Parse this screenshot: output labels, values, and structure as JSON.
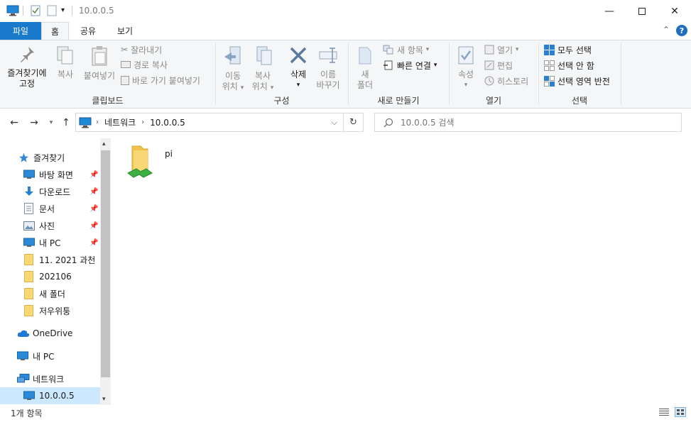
{
  "window": {
    "title": "10.0.0.5",
    "minimize_icon": "minimize-icon",
    "maximize_icon": "maximize-icon",
    "close_icon": "close-icon"
  },
  "ribbon_tabs": [
    "파일",
    "홈",
    "공유",
    "보기"
  ],
  "ribbon": {
    "clipboard": {
      "label": "클립보드",
      "pin_quick": [
        "즐겨찾기에",
        "고정"
      ],
      "copy": "복사",
      "paste": "붙여넣기",
      "cut": "잘라내기",
      "copy_path": "경로 복사",
      "paste_shortcut": "바로 가기 붙여넣기"
    },
    "organize": {
      "label": "구성",
      "move_to": [
        "이동",
        "위치"
      ],
      "copy_to": [
        "복사",
        "위치"
      ],
      "delete": "삭제",
      "rename": [
        "이름",
        "바꾸기"
      ]
    },
    "new": {
      "label": "새로 만들기",
      "new_folder": [
        "새",
        "폴더"
      ],
      "new_item": "새 항목",
      "easy_access": "빠른 연결"
    },
    "open": {
      "label": "열기",
      "properties": "속성",
      "open": "열기",
      "edit": "편집",
      "history": "히스토리"
    },
    "select": {
      "label": "선택",
      "select_all": "모두 선택",
      "select_none": "선택 안 함",
      "invert": "선택 영역 반전"
    }
  },
  "address": {
    "crumbs": [
      "네트워크",
      "10.0.0.5"
    ],
    "search_placeholder": "10.0.0.5 검색"
  },
  "nav_pane": {
    "quick_access": "즐겨찾기",
    "pinned": [
      {
        "label": "바탕 화면",
        "icon": "desktop-icon"
      },
      {
        "label": "다운로드",
        "icon": "download-icon"
      },
      {
        "label": "문서",
        "icon": "documents-icon"
      },
      {
        "label": "사진",
        "icon": "pictures-icon"
      },
      {
        "label": "내 PC",
        "icon": "pc-icon"
      }
    ],
    "folders": [
      "11. 2021 과천",
      "202106",
      "새 폴더",
      "저우위퉁"
    ],
    "onedrive": "OneDrive",
    "this_pc": "내 PC",
    "network": "네트워크",
    "selected": "10.0.0.5"
  },
  "content": {
    "items": [
      {
        "name": "pi",
        "icon": "shared-folder-icon"
      }
    ]
  },
  "status": {
    "count": "1개 항목"
  },
  "colors": {
    "file_tab": "#1979ca",
    "selected_nav": "#cce8ff",
    "folder_yellow": "#f8d775"
  }
}
